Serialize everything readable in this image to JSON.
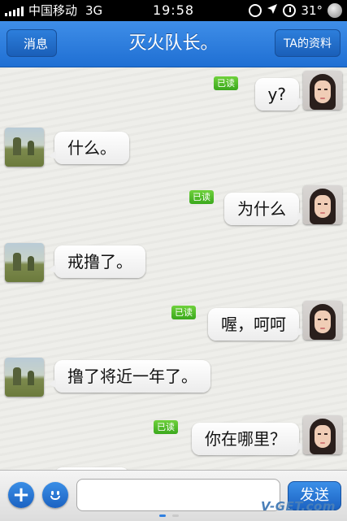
{
  "status_bar": {
    "carrier": "中国移动",
    "network": "3G",
    "time": "19:58",
    "temperature": "31°",
    "icons": [
      "signal-icon",
      "rotation-lock-icon",
      "location-arrow-icon",
      "alarm-clock-icon",
      "weather-icon"
    ]
  },
  "navbar": {
    "back_label": "消息",
    "title": "灭火队长。",
    "profile_label": "TA的资料",
    "accent_color": "#2a7ee0"
  },
  "messages": [
    {
      "from": "me",
      "text": "y?",
      "read_label": "已读"
    },
    {
      "from": "other",
      "text": "什么。"
    },
    {
      "from": "me",
      "text": "为什么",
      "read_label": "已读"
    },
    {
      "from": "other",
      "text": "戒撸了。"
    },
    {
      "from": "me",
      "text": "喔，呵呵",
      "read_label": "已读"
    },
    {
      "from": "other",
      "text": "撸了将近一年了。"
    },
    {
      "from": "me",
      "text": "你在哪里？",
      "read_label": "已读"
    }
  ],
  "input_bar": {
    "plus_icon": "plus-icon",
    "emoji_icon": "emoji-icon",
    "input_value": "",
    "send_label": "发送",
    "watermark": "V-GET.com"
  },
  "colors": {
    "read_badge": "#4cbb28",
    "bubble": "#ffffff",
    "nav_blue": "#2a7ee0"
  }
}
